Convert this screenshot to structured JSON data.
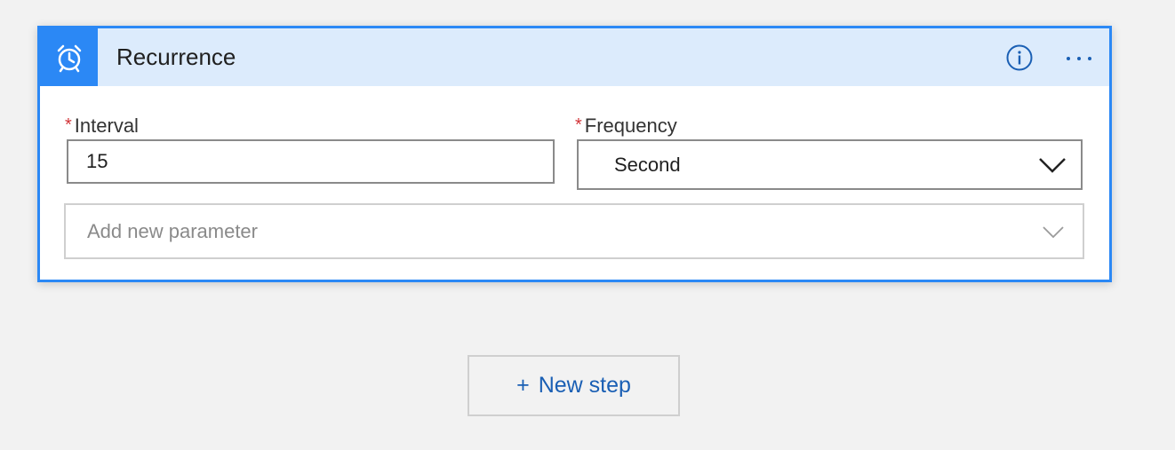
{
  "card": {
    "title": "Recurrence",
    "header_icon": "alarm-clock-icon",
    "actions": {
      "info_icon": "info-icon",
      "more_icon": "more-options-icon"
    },
    "accent_color": "#2b88f5",
    "header_bg_color": "#dcebfc"
  },
  "fields": {
    "interval": {
      "required_mark": "*",
      "label": "Interval",
      "value": "15"
    },
    "frequency": {
      "required_mark": "*",
      "label": "Frequency",
      "selected": "Second"
    },
    "add_parameter": {
      "placeholder": "Add new parameter"
    }
  },
  "new_step": {
    "plus": "+",
    "label": "New step"
  }
}
